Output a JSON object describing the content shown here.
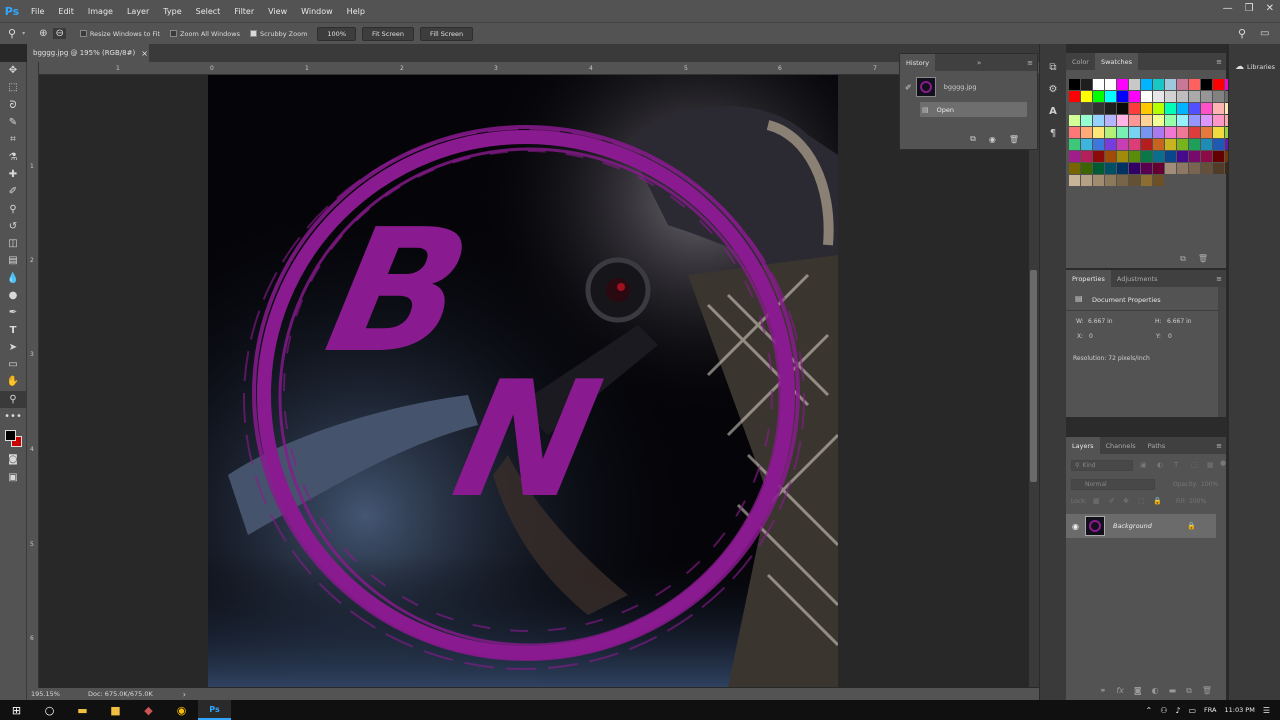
{
  "app": {
    "logo": "Ps"
  },
  "menu": {
    "items": [
      "File",
      "Edit",
      "Image",
      "Layer",
      "Type",
      "Select",
      "Filter",
      "View",
      "Window",
      "Help"
    ]
  },
  "window_controls": {
    "minimize": "—",
    "restore": "❐",
    "close": "✕"
  },
  "options_bar": {
    "resize_windows_label": "Resize Windows to Fit",
    "resize_windows_checked": false,
    "zoom_all_label": "Zoom All Windows",
    "zoom_all_checked": false,
    "scrubby_zoom_label": "Scrubby Zoom",
    "scrubby_zoom_checked": true,
    "pct_button": "100%",
    "fit_screen_button": "Fit Screen",
    "fill_screen_button": "Fill Screen"
  },
  "document": {
    "tab_title": "bgggg.jpg @ 195% (RGB/8#)",
    "close_glyph": "×",
    "artwork_letters": [
      "B",
      "N"
    ]
  },
  "rulers": {
    "top": [
      "1",
      "0",
      "1",
      "2",
      "3",
      "4",
      "5",
      "6",
      "7"
    ],
    "left": [
      "1",
      "2",
      "3",
      "4",
      "5",
      "6"
    ]
  },
  "status": {
    "zoom": "195.15%",
    "doc_info": "Doc: 675.0K/675.0K"
  },
  "history": {
    "tab": "History",
    "snapshot_name": "bgggg.jpg",
    "steps": [
      "Open"
    ]
  },
  "swatches_panel": {
    "tabs": [
      "Color",
      "Swatches"
    ],
    "active_tab": "Swatches"
  },
  "swatch_colors": [
    "#000000",
    "#1e1e1e",
    "#ffffff",
    "#ffffff",
    "#ff00ff",
    "#c8c8c8",
    "#00b4ff",
    "#18c6c6",
    "#a0c8dc",
    "#c87896",
    "#ff6060",
    "#000000",
    "#ff0000",
    "#ff00c8",
    "#ff0000",
    "#ffff00",
    "#00ff00",
    "#00ffff",
    "#0000ff",
    "#ff00ff",
    "#ffffff",
    "#e6e6e6",
    "#d2d2d2",
    "#bebebe",
    "#aaaaaa",
    "#969696",
    "#828282",
    "#6e6e6e",
    "#5a5a5a",
    "#464646",
    "#323232",
    "#1e1e1e",
    "#0a0a0a",
    "#ff3c3c",
    "#ffc800",
    "#b4ff00",
    "#00ffb4",
    "#00b4ff",
    "#5050ff",
    "#ff50c8",
    "#ffb4b4",
    "#ffe6b4",
    "#d2ff96",
    "#96ffd2",
    "#96d2ff",
    "#b4b4ff",
    "#ffb4e6",
    "#ff9696",
    "#ffd296",
    "#f0ff96",
    "#96ffaa",
    "#96f0ff",
    "#9696ff",
    "#dc96ff",
    "#ff96c8",
    "#ffaaaa",
    "#ff7878",
    "#ffaa78",
    "#ffe678",
    "#b4f078",
    "#78f0b4",
    "#78d2f0",
    "#7896f0",
    "#aa78f0",
    "#f078d2",
    "#f07896",
    "#dc3c3c",
    "#e6783c",
    "#f0dc3c",
    "#96d23c",
    "#3cc878",
    "#3cb4dc",
    "#3c78dc",
    "#783cdc",
    "#c83cb4",
    "#dc3c78",
    "#b41e1e",
    "#c8641e",
    "#c8b41e",
    "#78b41e",
    "#1ea05a",
    "#1e8cb4",
    "#1e5ab4",
    "#5a1eb4",
    "#a01e8c",
    "#b41e5a",
    "#8c0a0a",
    "#a04b0a",
    "#a08c0a",
    "#5a8c0a",
    "#0a7846",
    "#0a6e8c",
    "#0a468c",
    "#460a8c",
    "#780a6e",
    "#8c0a46",
    "#640000",
    "#783700",
    "#786400",
    "#3c6400",
    "#005a32",
    "#005064",
    "#003264",
    "#320064",
    "#5a0050",
    "#640032",
    "#a08c78",
    "#8c7864",
    "#786450",
    "#64503c",
    "#503c28",
    "#3c2814",
    "#c8b496",
    "#b4a082",
    "#a08c6e",
    "#8c785a",
    "#786446",
    "#645032",
    "#8c6e32",
    "#6e5028"
  ],
  "properties_panel": {
    "tabs": [
      "Properties",
      "Adjustments"
    ],
    "active_tab": "Properties",
    "header": "Document Properties",
    "w_label": "W:",
    "w_value": "6.667 in",
    "h_label": "H:",
    "h_value": "6.667 in",
    "x_label": "X:",
    "x_value": "0",
    "y_label": "Y:",
    "y_value": "0",
    "resolution": "Resolution: 72 pixels/inch"
  },
  "layers_panel": {
    "tabs": [
      "Layers",
      "Channels",
      "Paths"
    ],
    "active_tab": "Layers",
    "kind_filter": "Kind",
    "blend_mode": "Normal",
    "opacity_label": "Opacity:",
    "opacity_value": "100%",
    "lock_label": "Lock:",
    "fill_label": "Fill:",
    "fill_value": "100%",
    "layer_name": "Background"
  },
  "libraries": {
    "label": "Libraries"
  },
  "taskbar": {
    "time": "11:03 PM",
    "lang": "FRA"
  },
  "colors": {
    "accent": "#31a8ff",
    "brand_purple": "#8a1a8f",
    "panel": "#535353",
    "panel_dark": "#3a3a3a",
    "canvas_bg": "#282828"
  }
}
